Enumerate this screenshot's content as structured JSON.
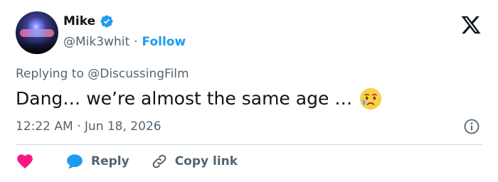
{
  "author": {
    "name": "Mike",
    "handle": "@Mik3whit",
    "separator": "·",
    "follow_label": "Follow"
  },
  "tweet": {
    "replying_to_label": "Replying to @DiscussingFilm",
    "text": "Dang… we’re almost the same age …",
    "emoji": "sad-but-relieved-face",
    "timestamp": "12:22 AM · Jun 18, 2026"
  },
  "actions": {
    "reply_label": "Reply",
    "copy_link_label": "Copy link"
  },
  "colors": {
    "accent": "#1d9bf0",
    "like": "#f91880",
    "secondary_text": "#536471",
    "divider": "#cfd9de"
  },
  "icons": [
    "verified-badge-icon",
    "x-logo-icon",
    "info-icon",
    "heart-icon",
    "reply-bubble-icon",
    "link-icon"
  ]
}
